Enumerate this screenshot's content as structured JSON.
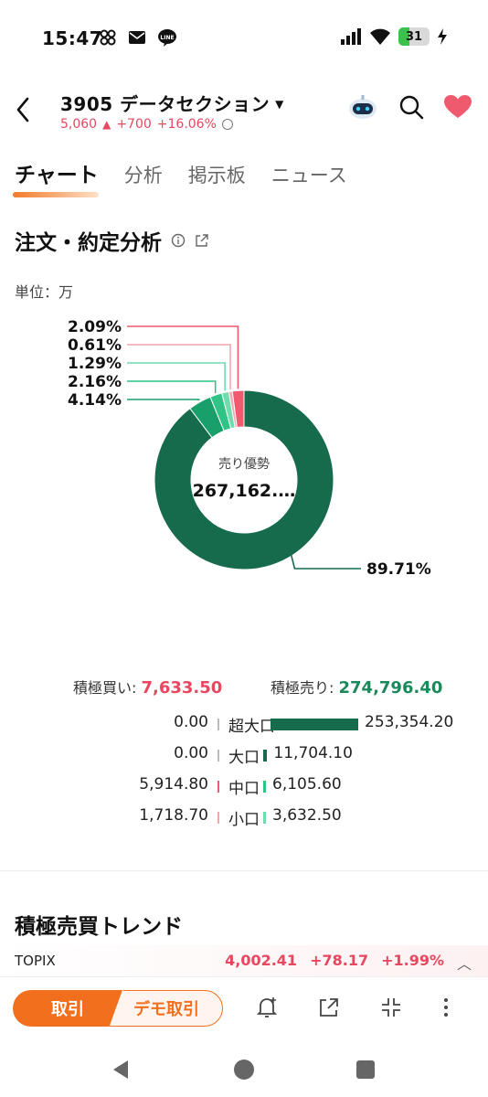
{
  "status": {
    "time": "15:47",
    "battery": "31"
  },
  "header": {
    "stock_title": "3905 データセクション",
    "price": "5,060",
    "change": "+700",
    "change_pct": "+16.06%"
  },
  "tabs": [
    "チャート",
    "分析",
    "掲示板",
    "ニュース"
  ],
  "section": {
    "title": "注文・約定分析",
    "unit": "単位：万"
  },
  "donut": {
    "center_label": "売り優勢",
    "center_value": "267,162.…",
    "slices": [
      {
        "label": "89.71%",
        "value": 89.71,
        "color": "#156b4b"
      },
      {
        "label": "4.14%",
        "value": 4.14,
        "color": "#19a06a"
      },
      {
        "label": "2.16%",
        "value": 2.16,
        "color": "#2fc486"
      },
      {
        "label": "1.29%",
        "value": 1.29,
        "color": "#6fdcae"
      },
      {
        "label": "0.61%",
        "value": 0.61,
        "color": "#f6a4ae"
      },
      {
        "label": "2.09%",
        "value": 2.09,
        "color": "#ef5a6f"
      }
    ]
  },
  "summary": {
    "buy_label": "積極買い:",
    "buy_value": "7,633.50",
    "sell_label": "積極売り:",
    "sell_value": "274,796.40"
  },
  "tiers": [
    {
      "name": "超大口",
      "buy": "0.00",
      "sell": "253,354.20",
      "sell_ratio": 1.0,
      "sell_color": "#156b4b",
      "buy_color": "#bbbbbb"
    },
    {
      "name": "大口",
      "buy": "0.00",
      "sell": "11,704.10",
      "sell_ratio": 0.046,
      "sell_color": "#156b4b",
      "buy_color": "#bbbbbb"
    },
    {
      "name": "中口",
      "buy": "5,914.80",
      "sell": "6,105.60",
      "sell_ratio": 0.024,
      "sell_color": "#2fc486",
      "buy_color": "#ef5a6f"
    },
    {
      "name": "小口",
      "buy": "1,718.70",
      "sell": "3,632.50",
      "sell_ratio": 0.014,
      "sell_color": "#6fdcae",
      "buy_color": "#f6a4ae"
    }
  ],
  "trend": {
    "title": "積極売買トレンド"
  },
  "ticker": {
    "name": "TOPIX",
    "value": "4,002.41",
    "change": "+78.17",
    "pct": "+1.99%"
  },
  "bottom": {
    "trade_label": "取引",
    "demo_label": "デモ取引"
  }
}
